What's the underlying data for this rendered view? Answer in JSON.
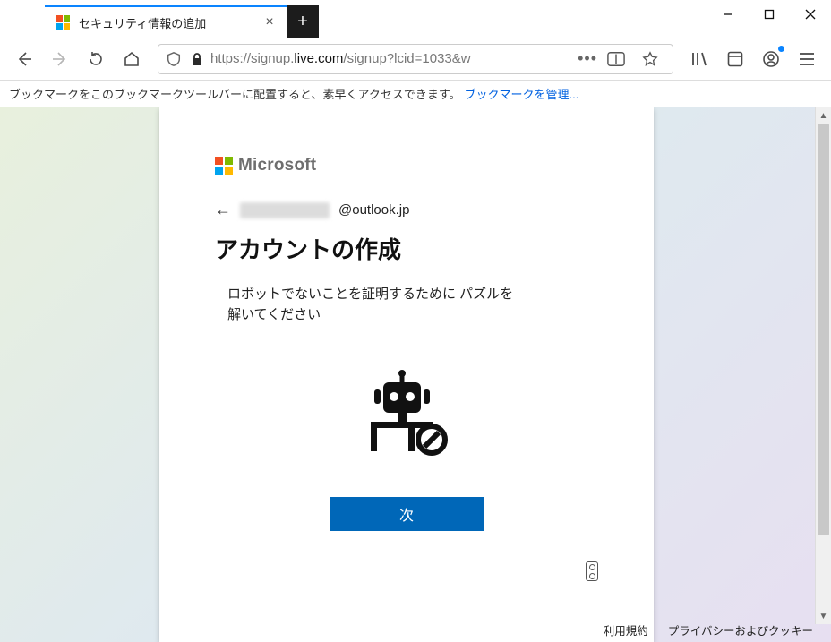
{
  "window": {
    "tab_title": "セキュリティ情報の追加"
  },
  "navbar": {
    "url_prefix": "https://signup.",
    "url_host": "live.com",
    "url_suffix": "/signup?lcid=1033&w"
  },
  "bookmarkbar": {
    "hint_text": "ブックマークをこのブックマークツールバーに配置すると、素早くアクセスできます。",
    "manage_link": "ブックマークを管理..."
  },
  "page": {
    "brand": "Microsoft",
    "email_domain": "@outlook.jp",
    "heading": "アカウントの作成",
    "instruction": "ロボットでないことを証明するために パズルを解いてください",
    "next_button": "次",
    "footer_terms": "利用規約",
    "footer_privacy": "プライバシーおよびクッキー"
  }
}
